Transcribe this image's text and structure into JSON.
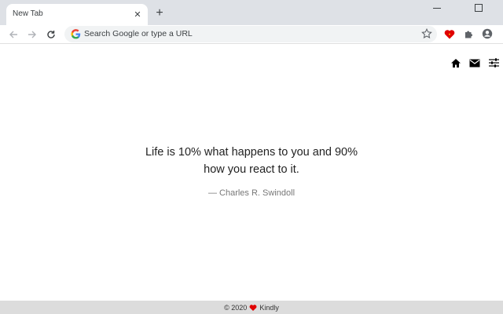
{
  "browser": {
    "tab_title": "New Tab",
    "tab_close_icon": "close-icon",
    "new_tab_icon": "plus-icon",
    "omnibox_placeholder": "Search Google or type a URL"
  },
  "page": {
    "icons": [
      "home-icon",
      "envelope-icon",
      "sliders-icon"
    ],
    "quote_line1": "Life is 10% what happens to you and 90%",
    "quote_line2": "how you react to it.",
    "author": "— Charles R. Swindoll"
  },
  "footer": {
    "prefix": "© 2020",
    "brand": "Kindly",
    "heart_color": "#e00000"
  }
}
